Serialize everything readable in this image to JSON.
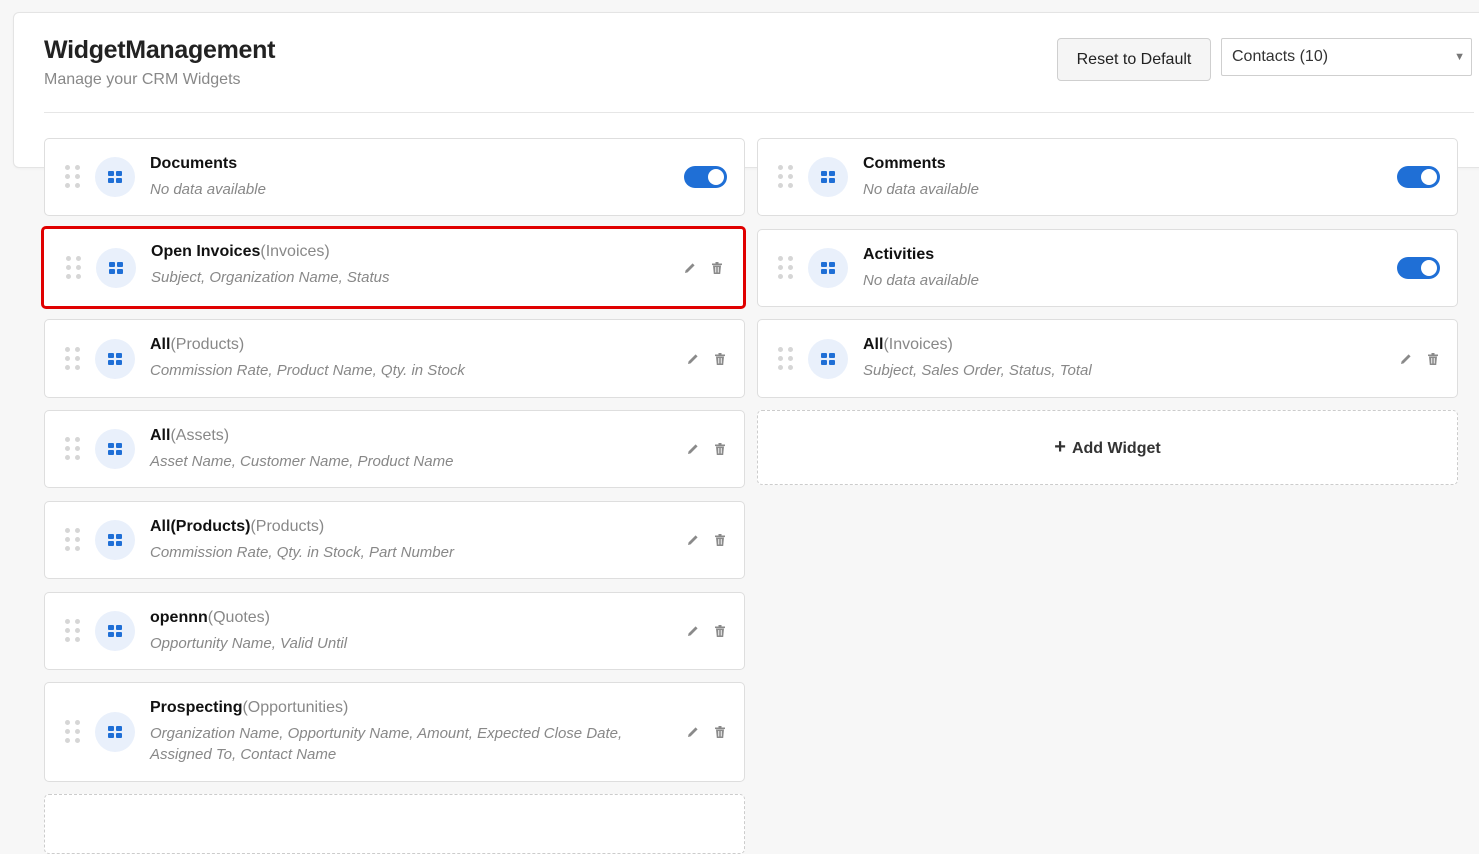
{
  "header": {
    "title": "WidgetManagement",
    "subtitle": "Manage your CRM Widgets",
    "reset_label": "Reset to Default",
    "module_select": "Contacts (10)"
  },
  "left_widgets": [
    {
      "name": "Documents",
      "module": "",
      "fields": "No data available",
      "control": "toggle",
      "enabled": true
    },
    {
      "name": "Open Invoices",
      "module": "(Invoices)",
      "fields": "Subject, Organization Name, Status",
      "control": "edit-delete",
      "highlighted": true
    },
    {
      "name": "All",
      "module": "(Products)",
      "fields": "Commission Rate, Product Name, Qty. in Stock",
      "control": "edit-delete"
    },
    {
      "name": "All",
      "module": "(Assets)",
      "fields": "Asset Name, Customer Name, Product Name",
      "control": "edit-delete"
    },
    {
      "name": "All(Products)",
      "module": "(Products)",
      "fields": "Commission Rate, Qty. in Stock, Part Number",
      "control": "edit-delete"
    },
    {
      "name": "opennn",
      "module": "(Quotes)",
      "fields": "Opportunity Name, Valid Until",
      "control": "edit-delete"
    },
    {
      "name": "Prospecting",
      "module": "(Opportunities)",
      "fields": "Organization Name, Opportunity Name, Amount, Expected Close Date, Assigned To, Contact Name",
      "control": "edit-delete"
    }
  ],
  "right_widgets": [
    {
      "name": "Comments",
      "module": "",
      "fields": "No data available",
      "control": "toggle",
      "enabled": true
    },
    {
      "name": "Activities",
      "module": "",
      "fields": "No data available",
      "control": "toggle",
      "enabled": true
    },
    {
      "name": "All",
      "module": "(Invoices)",
      "fields": "Subject, Sales Order, Status, Total",
      "control": "edit-delete"
    }
  ],
  "add_widget": {
    "icon": "+",
    "label": "Add Widget"
  },
  "icons": {
    "drag": "drag-handle-icon",
    "widget": "grid-icon",
    "edit": "pencil-icon",
    "delete": "trash-icon"
  },
  "colors": {
    "accent": "#1f6fd6",
    "highlight": "#e00000"
  }
}
